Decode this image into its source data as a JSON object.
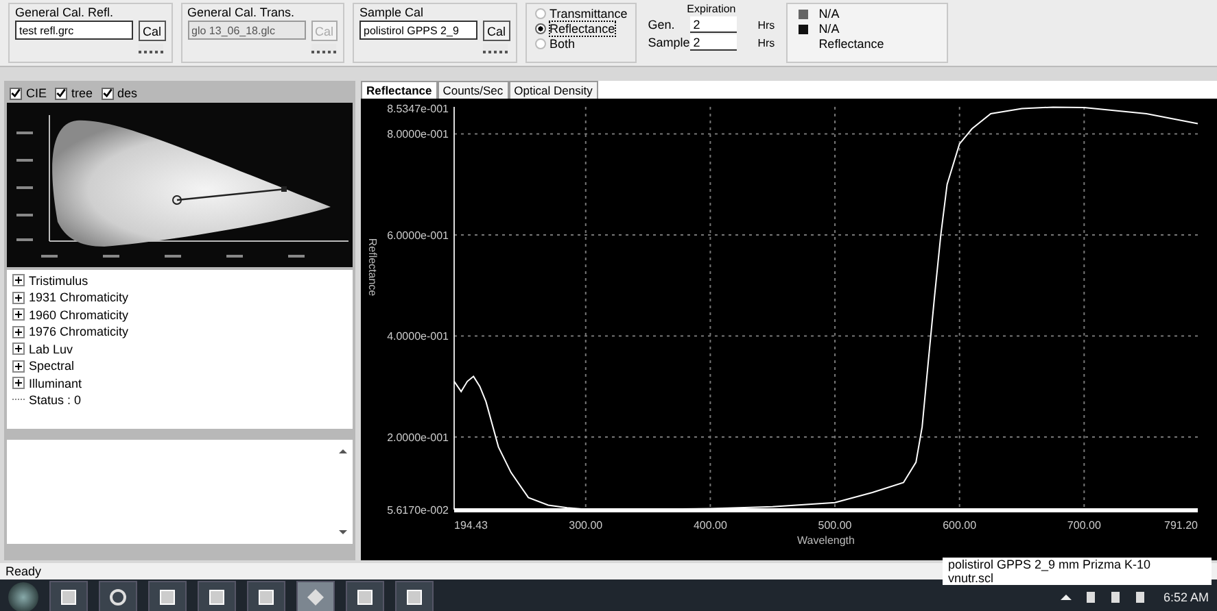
{
  "toolbar": {
    "calibration_groups": [
      {
        "title": "General Cal. Refl.",
        "value": "test refl.grc",
        "disabled": false,
        "button": "Cal"
      },
      {
        "title": "General Cal. Trans.",
        "value": "glo 13_06_18.glc",
        "disabled": true,
        "button": "Cal"
      },
      {
        "title": "Sample Cal",
        "value": "polistirol GPPS 2_9",
        "disabled": false,
        "button": "Cal"
      }
    ],
    "mode_options": [
      {
        "label": "Transmittance",
        "selected": false
      },
      {
        "label": "Reflectance",
        "selected": true
      },
      {
        "label": "Both",
        "selected": false
      }
    ],
    "expiration": {
      "title": "Expiration",
      "rows": [
        {
          "label": "Gen.",
          "value": "2",
          "unit": "Hrs"
        },
        {
          "label": "Sample",
          "value": "2",
          "unit": "Hrs"
        }
      ]
    },
    "legend": [
      {
        "label": "N/A",
        "color": "#666666"
      },
      {
        "label": "N/A",
        "color": "#111111"
      },
      {
        "label": "Reflectance"
      }
    ]
  },
  "diagram_options": [
    {
      "label": "CIE",
      "checked": true
    },
    {
      "label": "tree",
      "checked": true
    },
    {
      "label": "des",
      "checked": true
    }
  ],
  "tree": [
    {
      "label": "Tristimulus",
      "kind": "group",
      "expanded": false
    },
    {
      "label": "1931 Chromaticity",
      "kind": "group",
      "expanded": false
    },
    {
      "label": "1960 Chromaticity",
      "kind": "group",
      "expanded": false
    },
    {
      "label": "1976 Chromaticity",
      "kind": "group",
      "expanded": false
    },
    {
      "label": "Lab Luv",
      "kind": "group",
      "expanded": false
    },
    {
      "label": "Spectral",
      "kind": "group",
      "expanded": false
    },
    {
      "label": "Illuminant",
      "kind": "group",
      "expanded": false
    },
    {
      "label": "Status : 0",
      "kind": "leaf"
    }
  ],
  "tabs": [
    {
      "label": "Reflectance",
      "selected": true
    },
    {
      "label": "Counts/Sec",
      "selected": false
    },
    {
      "label": "Optical Density",
      "selected": false
    }
  ],
  "chart": {
    "chart_data": {
      "type": "line",
      "xlabel": "Wavelength",
      "ylabel": "Reflectance",
      "x": [
        194.43,
        200,
        205,
        210,
        215,
        220,
        230,
        240,
        254,
        270,
        285,
        300,
        350,
        400,
        450,
        500,
        530,
        555,
        565,
        570,
        575,
        580,
        585,
        590,
        600,
        610,
        625,
        650,
        675,
        700,
        750,
        791.2
      ],
      "grid": true,
      "series": [
        {
          "color": "#ffffff",
          "values": [
            0.31,
            0.29,
            0.31,
            0.32,
            0.3,
            0.27,
            0.18,
            0.13,
            0.08,
            0.065,
            0.06,
            0.057,
            0.057,
            0.058,
            0.062,
            0.07,
            0.09,
            0.11,
            0.15,
            0.22,
            0.35,
            0.48,
            0.6,
            0.7,
            0.78,
            0.81,
            0.84,
            0.85,
            0.853,
            0.852,
            0.84,
            0.82
          ]
        }
      ],
      "xlim": [
        194.43,
        791.2
      ],
      "ylim": [
        0.05617,
        0.85347
      ],
      "xticks": [
        {
          "value": 194.43,
          "label": "194.43"
        },
        {
          "value": 300,
          "label": "300.00"
        },
        {
          "value": 400,
          "label": "400.00"
        },
        {
          "value": 500,
          "label": "500.00"
        },
        {
          "value": 600,
          "label": "600.00"
        },
        {
          "value": 700,
          "label": "700.00"
        },
        {
          "value": 791.2,
          "label": "791.20"
        }
      ],
      "yticks": [
        {
          "value": 0.05617,
          "label": "5.6170e-002"
        },
        {
          "value": 0.2,
          "label": "2.0000e-001"
        },
        {
          "value": 0.4,
          "label": "4.0000e-001"
        },
        {
          "value": 0.6,
          "label": "6.0000e-001"
        },
        {
          "value": 0.8,
          "label": "8.0000e-001"
        },
        {
          "value": 0.85347,
          "label": "8.5347e-001"
        }
      ]
    }
  },
  "status_bar": {
    "text": "Ready",
    "file": "polistirol GPPS 2_9 mm Prizma K-10 vnutr.scl"
  },
  "taskbar": {
    "clock": "6:52 AM"
  }
}
